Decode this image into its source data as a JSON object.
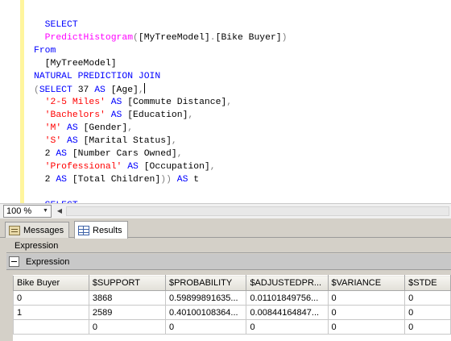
{
  "editor": {
    "lines": [
      [
        {
          "c": "kw",
          "t": "  SELECT"
        }
      ],
      [
        {
          "c": "fn",
          "t": "  PredictHistogram"
        },
        {
          "c": "gr",
          "t": "("
        },
        {
          "c": "id",
          "t": "[MyTreeModel]"
        },
        {
          "c": "gr",
          "t": "."
        },
        {
          "c": "id",
          "t": "[Bike Buyer]"
        },
        {
          "c": "gr",
          "t": ")"
        }
      ],
      [
        {
          "c": "kw",
          "t": "From"
        }
      ],
      [
        {
          "c": "id",
          "t": "  [MyTreeModel]"
        }
      ],
      [
        {
          "c": "kw",
          "t": "NATURAL PREDICTION JOIN"
        }
      ],
      [
        {
          "c": "gr",
          "t": "("
        },
        {
          "c": "kw",
          "t": "SELECT"
        },
        {
          "c": "id",
          "t": " 37 "
        },
        {
          "c": "kw",
          "t": "AS"
        },
        {
          "c": "id",
          "t": " [Age]"
        },
        {
          "c": "gr",
          "t": ","
        },
        {
          "c": "caret",
          "t": ""
        }
      ],
      [
        {
          "c": "str",
          "t": "  '2-5 Miles'"
        },
        {
          "c": "id",
          "t": " "
        },
        {
          "c": "kw",
          "t": "AS"
        },
        {
          "c": "id",
          "t": " [Commute Distance]"
        },
        {
          "c": "gr",
          "t": ","
        }
      ],
      [
        {
          "c": "str",
          "t": "  'Bachelors'"
        },
        {
          "c": "id",
          "t": " "
        },
        {
          "c": "kw",
          "t": "AS"
        },
        {
          "c": "id",
          "t": " [Education]"
        },
        {
          "c": "gr",
          "t": ","
        }
      ],
      [
        {
          "c": "str",
          "t": "  'M'"
        },
        {
          "c": "id",
          "t": " "
        },
        {
          "c": "kw",
          "t": "AS"
        },
        {
          "c": "id",
          "t": " [Gender]"
        },
        {
          "c": "gr",
          "t": ","
        }
      ],
      [
        {
          "c": "str",
          "t": "  'S'"
        },
        {
          "c": "id",
          "t": " "
        },
        {
          "c": "kw",
          "t": "AS"
        },
        {
          "c": "id",
          "t": " [Marital Status]"
        },
        {
          "c": "gr",
          "t": ","
        }
      ],
      [
        {
          "c": "id",
          "t": "  2 "
        },
        {
          "c": "kw",
          "t": "AS"
        },
        {
          "c": "id",
          "t": " [Number Cars Owned]"
        },
        {
          "c": "gr",
          "t": ","
        }
      ],
      [
        {
          "c": "str",
          "t": "  'Professional'"
        },
        {
          "c": "id",
          "t": " "
        },
        {
          "c": "kw",
          "t": "AS"
        },
        {
          "c": "id",
          "t": " [Occupation]"
        },
        {
          "c": "gr",
          "t": ","
        }
      ],
      [
        {
          "c": "id",
          "t": "  2 "
        },
        {
          "c": "kw",
          "t": "AS"
        },
        {
          "c": "id",
          "t": " [Total Children]"
        },
        {
          "c": "gr",
          "t": "))"
        },
        {
          "c": "id",
          "t": " "
        },
        {
          "c": "kw",
          "t": "AS"
        },
        {
          "c": "id",
          "t": " t"
        }
      ],
      [
        {
          "c": "id",
          "t": ""
        }
      ],
      [
        {
          "c": "kw",
          "t": "  SELECT"
        }
      ]
    ]
  },
  "zoom": {
    "value": "100 %"
  },
  "tabs": [
    {
      "label": "Messages",
      "active": false
    },
    {
      "label": "Results",
      "active": true
    }
  ],
  "results": {
    "outer_header": "Expression",
    "expander_label": "Expression",
    "columns": [
      "Bike Buyer",
      "$SUPPORT",
      "$PROBABILITY",
      "$ADJUSTEDPR...",
      "$VARIANCE",
      "$STDE"
    ],
    "rows": [
      [
        "0",
        "3868",
        "0.59899891635...",
        "0.01101849756...",
        "0",
        "0"
      ],
      [
        "1",
        "2589",
        "0.40100108364...",
        "0.00844164847...",
        "0",
        "0"
      ],
      [
        "",
        "0",
        "0",
        "0",
        "0",
        "0"
      ]
    ]
  },
  "colors": {
    "keyword": "#0000ff",
    "function": "#ff00ff",
    "string": "#ff0000",
    "punctuation": "#808080"
  }
}
